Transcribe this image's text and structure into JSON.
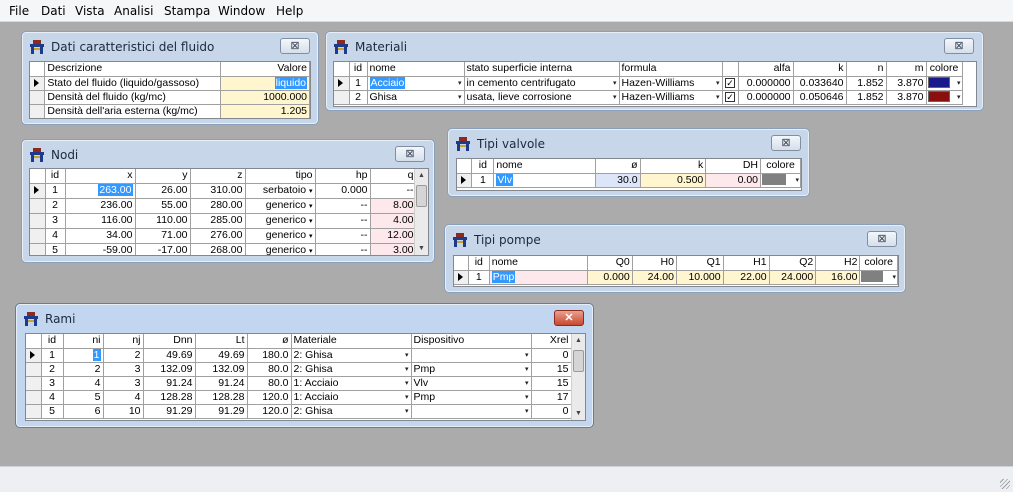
{
  "menu": [
    "File",
    "Dati",
    "Vista",
    "Analisi",
    "Stampa",
    "Window",
    "Help"
  ],
  "fluid": {
    "title": "Dati caratteristici del fluido",
    "close": "⊠",
    "headers": [
      "Descrizione",
      "Valore"
    ],
    "rows": [
      {
        "desc": "Stato del fluido (liquido/gassoso)",
        "value": "liquido"
      },
      {
        "desc": "Densità del fluido (kg/mc)",
        "value": "1000.000"
      },
      {
        "desc": "Densità dell'aria esterna (kg/mc)",
        "value": "1.205"
      }
    ]
  },
  "materiali": {
    "title": "Materiali",
    "close": "⊠",
    "headers": [
      "id",
      "nome",
      "stato superficie interna",
      "formula",
      "",
      "alfa",
      "k",
      "n",
      "m",
      "colore"
    ],
    "rows": [
      {
        "id": "1",
        "nome": "Acciaio",
        "stato": "in cemento centrifugato",
        "formula": "Hazen-Williams",
        "check": "✓",
        "alfa": "0.000000",
        "k": "0.033640",
        "n": "1.852",
        "m": "3.870",
        "colore": "#1a1a8c"
      },
      {
        "id": "2",
        "nome": "Ghisa",
        "stato": "usata, lieve corrosione",
        "formula": "Hazen-Williams",
        "check": "✓",
        "alfa": "0.000000",
        "k": "0.050646",
        "n": "1.852",
        "m": "3.870",
        "colore": "#8a1010"
      }
    ]
  },
  "nodi": {
    "title": "Nodi",
    "close": "⊠",
    "headers": [
      "id",
      "x",
      "y",
      "z",
      "tipo",
      "hp",
      "q"
    ],
    "rows": [
      {
        "id": "1",
        "x": "263.00",
        "y": "26.00",
        "z": "310.00",
        "tipo": "serbatoio",
        "hp": "0.000",
        "q": "--"
      },
      {
        "id": "2",
        "x": "236.00",
        "y": "55.00",
        "z": "280.00",
        "tipo": "generico",
        "hp": "--",
        "q": "8.00"
      },
      {
        "id": "3",
        "x": "116.00",
        "y": "110.00",
        "z": "285.00",
        "tipo": "generico",
        "hp": "--",
        "q": "4.00"
      },
      {
        "id": "4",
        "x": "34.00",
        "y": "71.00",
        "z": "276.00",
        "tipo": "generico",
        "hp": "--",
        "q": "12.00"
      },
      {
        "id": "5",
        "x": "-59.00",
        "y": "-17.00",
        "z": "268.00",
        "tipo": "generico",
        "hp": "--",
        "q": "3.00"
      }
    ]
  },
  "valvole": {
    "title": "Tipi valvole",
    "close": "⊠",
    "headers": [
      "id",
      "nome",
      "ø",
      "k",
      "DH",
      "colore"
    ],
    "rows": [
      {
        "id": "1",
        "nome": "Vlv",
        "diam": "30.0",
        "k": "0.500",
        "dh": "0.00",
        "colore": "#808080"
      }
    ]
  },
  "pompe": {
    "title": "Tipi pompe",
    "close": "⊠",
    "headers": [
      "id",
      "nome",
      "Q0",
      "H0",
      "Q1",
      "H1",
      "Q2",
      "H2",
      "colore"
    ],
    "rows": [
      {
        "id": "1",
        "nome": "Pmp",
        "q0": "0.000",
        "h0": "24.00",
        "q1": "10.000",
        "h1": "22.00",
        "q2": "24.000",
        "h2": "16.00",
        "colore": "#808080"
      }
    ]
  },
  "rami": {
    "title": "Rami",
    "close": "✕",
    "headers": [
      "id",
      "ni",
      "nj",
      "Dnn",
      "Lt",
      "ø",
      "Materiale",
      "Dispositivo",
      "Xrel"
    ],
    "rows": [
      {
        "id": "1",
        "ni": "1",
        "nj": "2",
        "dnn": "49.69",
        "lt": "49.69",
        "diam": "180.0",
        "mat": "2: Ghisa",
        "disp": "",
        "xrel": "0"
      },
      {
        "id": "2",
        "ni": "2",
        "nj": "3",
        "dnn": "132.09",
        "lt": "132.09",
        "diam": "80.0",
        "mat": "2: Ghisa",
        "disp": "Pmp",
        "xrel": "15"
      },
      {
        "id": "3",
        "ni": "4",
        "nj": "3",
        "dnn": "91.24",
        "lt": "91.24",
        "diam": "80.0",
        "mat": "1: Acciaio",
        "disp": "Vlv",
        "xrel": "15"
      },
      {
        "id": "4",
        "ni": "5",
        "nj": "4",
        "dnn": "128.28",
        "lt": "128.28",
        "diam": "120.0",
        "mat": "1: Acciaio",
        "disp": "Pmp",
        "xrel": "17"
      },
      {
        "id": "5",
        "ni": "6",
        "nj": "10",
        "dnn": "91.29",
        "lt": "91.29",
        "diam": "120.0",
        "mat": "2: Ghisa",
        "disp": "",
        "xrel": "0"
      }
    ]
  },
  "icons": {
    "window_icon": "grid-table-icon",
    "dropdown": "▾"
  }
}
